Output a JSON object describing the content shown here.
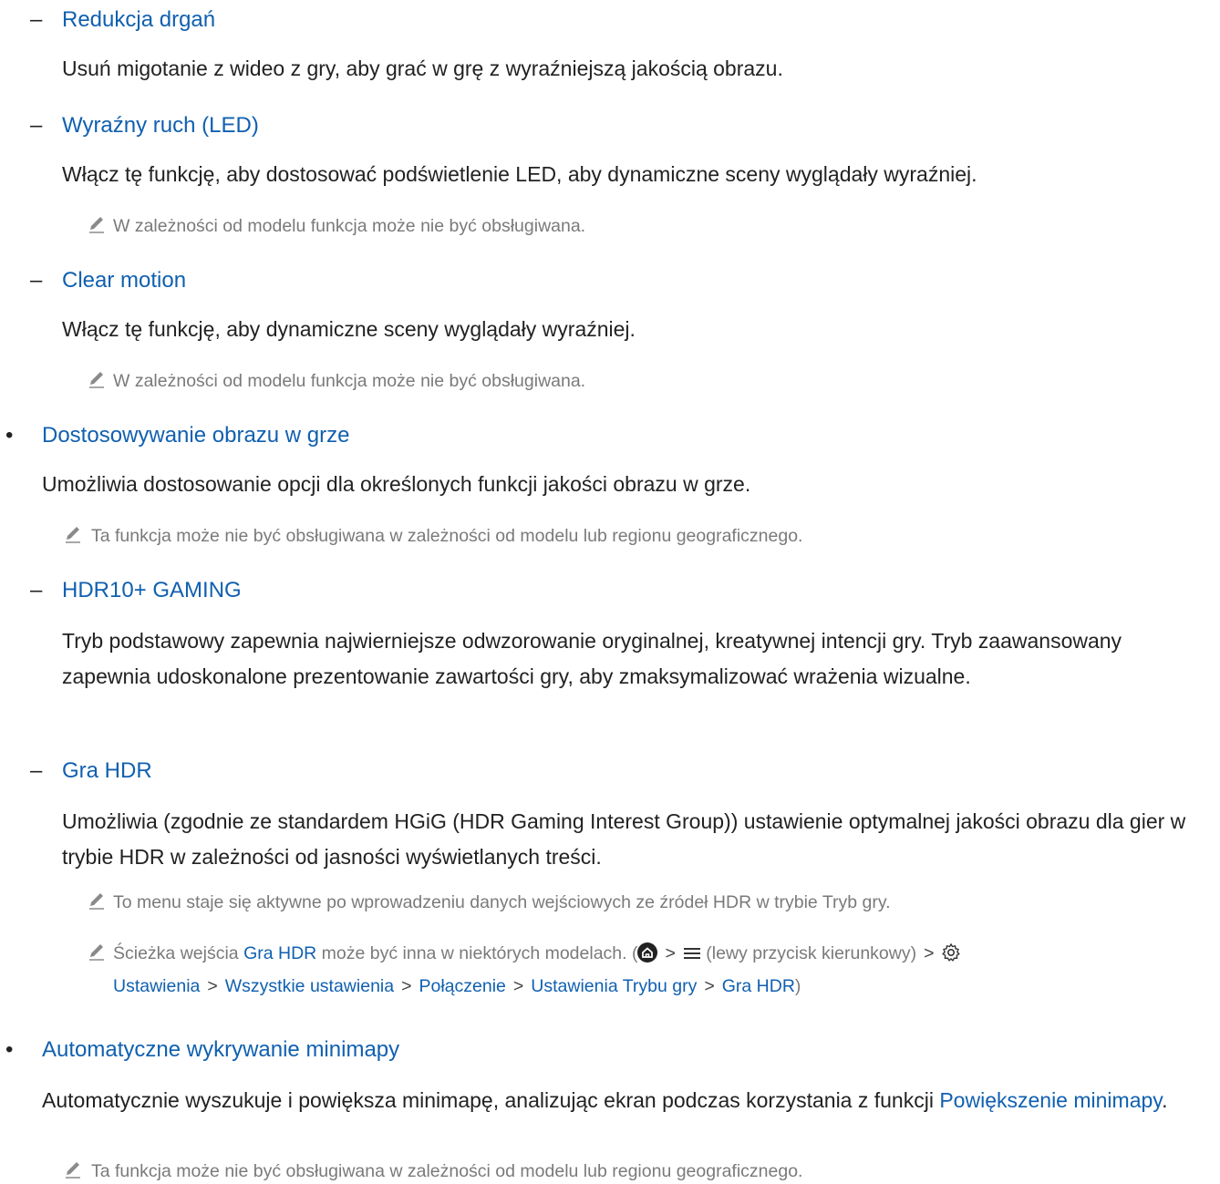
{
  "items": {
    "reduction": {
      "title": "Redukcja drgań",
      "desc": "Usuń migotanie z wideo z gry, aby grać w grę z wyraźniejszą jakością obrazu."
    },
    "clear_led": {
      "title": "Wyraźny ruch (LED)",
      "desc": "Włącz tę funkcję, aby dostosować podświetlenie LED, aby dynamiczne sceny wyglądały wyraźniej.",
      "note": "W zależności od modelu funkcja może nie być obsługiwana."
    },
    "clear_motion": {
      "title": "Clear motion",
      "desc": "Włącz tę funkcję, aby dynamiczne sceny wyglądały wyraźniej.",
      "note": "W zależności od modelu funkcja może nie być obsługiwana."
    },
    "game_picture": {
      "title": "Dostosowywanie obrazu w grze",
      "desc": "Umożliwia dostosowanie opcji dla określonych funkcji jakości obrazu w grze.",
      "note": "Ta funkcja może nie być obsługiwana w zależności od modelu lub regionu geograficznego."
    },
    "hdr10": {
      "title": "HDR10+ GAMING",
      "desc": "Tryb podstawowy zapewnia najwierniejsze odwzorowanie oryginalnej, kreatywnej intencji gry. Tryb zaawansowany zapewnia udoskonalone prezentowanie zawartości gry, aby zmaksymalizować wrażenia wizualne."
    },
    "gra_hdr": {
      "title": "Gra HDR",
      "desc": "Umożliwia (zgodnie ze standardem HGiG (HDR Gaming Interest Group)) ustawienie optymalnej jakości obrazu dla gier w trybie HDR w zależności od jasności wyświetlanych treści.",
      "note1": "To menu staje się aktywne po wprowadzeniu danych wejściowych ze źródeł HDR w trybie Tryb gry.",
      "note2_prefix": "Ścieżka wejścia",
      "note2_link": "Gra HDR",
      "note2_mid": "może być inna w niektórych modelach. (",
      "note2_menu": "(lewy przycisk kierunkowy)",
      "path": [
        "Ustawienia",
        "Wszystkie ustawienia",
        "Połączenie",
        "Ustawienia Trybu gry",
        "Gra HDR"
      ],
      "close_paren": ")"
    },
    "minimap": {
      "title": "Automatyczne wykrywanie minimapy",
      "desc_prefix": "Automatycznie wyszukuje i powiększa minimapę, analizując ekran podczas korzystania z funkcji",
      "desc_link": "Powiększenie minimapy",
      "desc_suffix": ".",
      "note": "Ta funkcja może nie być obsługiwana w zależności od modelu lub regionu geograficznego."
    }
  },
  "symbols": {
    "dash": "–",
    "bullet": "•",
    "chevron": ">"
  },
  "icons": [
    "pencil-note-icon",
    "home-icon",
    "menu-icon",
    "gear-icon"
  ]
}
